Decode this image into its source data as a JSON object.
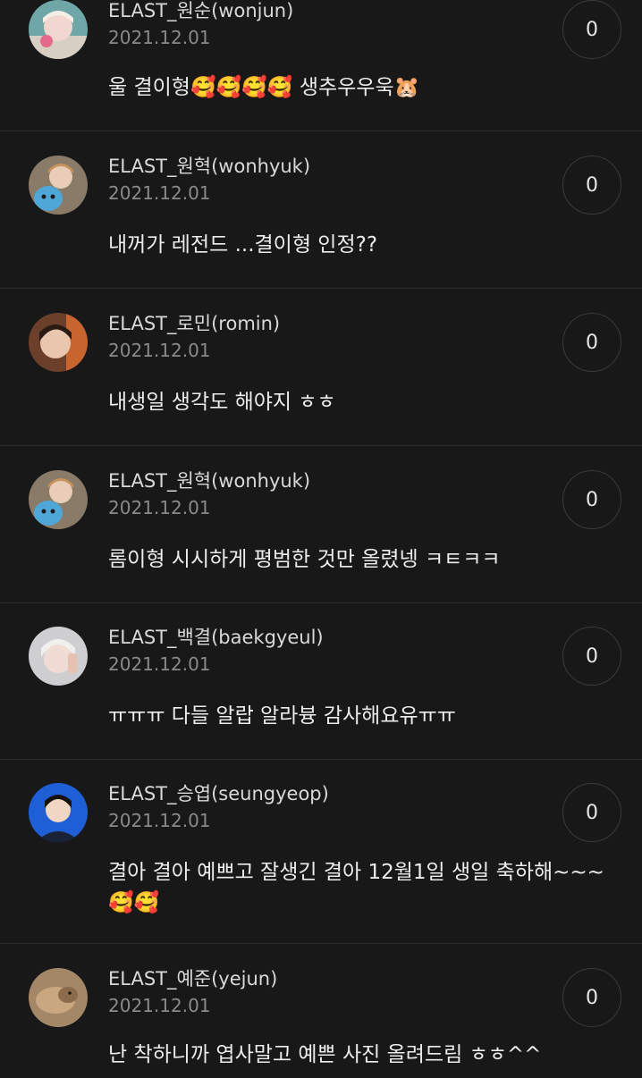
{
  "comments": [
    {
      "username": "ELAST_원순(wonjun)",
      "date": "2021.12.01",
      "text": "울 결이형🥰🥰🥰🥰 생추우우욱🐹",
      "likes": "0"
    },
    {
      "username": "ELAST_원혁(wonhyuk)",
      "date": "2021.12.01",
      "text": "내꺼가 레전드 ...결이형 인정??",
      "likes": "0"
    },
    {
      "username": "ELAST_로민(romin)",
      "date": "2021.12.01",
      "text": "내생일 생각도 해야지 ㅎㅎ",
      "likes": "0"
    },
    {
      "username": "ELAST_원혁(wonhyuk)",
      "date": "2021.12.01",
      "text": "롬이형 시시하게 평범한 것만 올렸넹 ㅋㅌㅋㅋ",
      "likes": "0"
    },
    {
      "username": "ELAST_백결(baekgyeul)",
      "date": "2021.12.01",
      "text": "ㅠㅠㅠ 다들 알랍 알라븅 감사해요유ㅠㅠ",
      "likes": "0"
    },
    {
      "username": "ELAST_승엽(seungyeop)",
      "date": "2021.12.01",
      "text": "결아 결아 예쁘고 잘생긴 결아 12월1일 생일 축하해~~~🥰🥰",
      "likes": "0"
    },
    {
      "username": "ELAST_예준(yejun)",
      "date": "2021.12.01",
      "text": "난 착하니까 엽사말고 예쁜 사진 올려드림 ㅎㅎ^^",
      "likes": "0"
    }
  ]
}
